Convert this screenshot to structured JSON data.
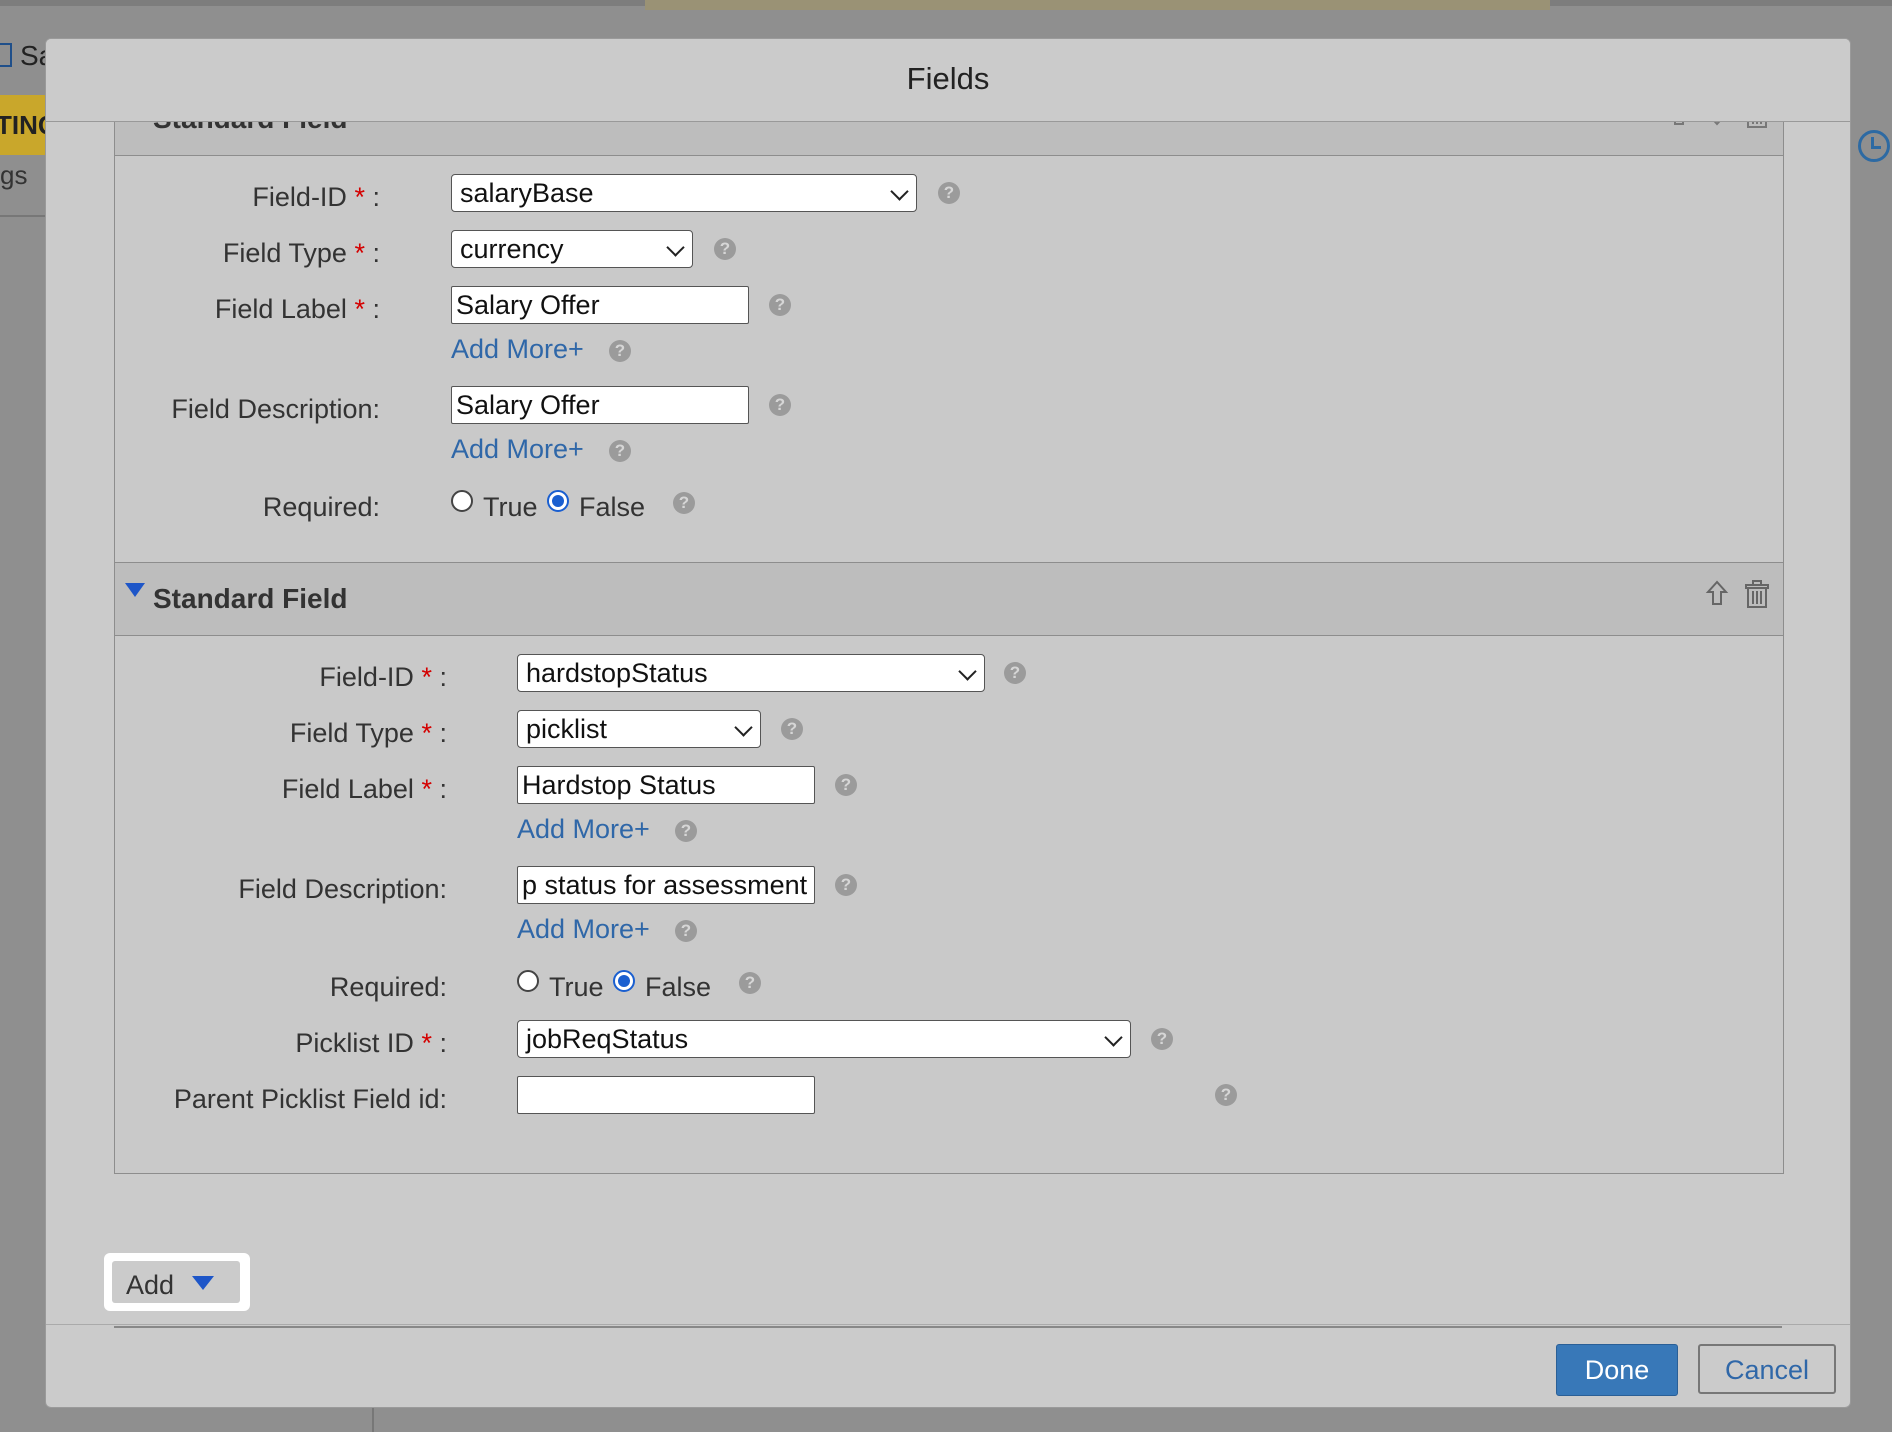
{
  "background": {
    "page_title_fragment": "Sa",
    "band_text": "TING",
    "side_text": "gs"
  },
  "modal": {
    "title": "Fields",
    "sections": [
      {
        "title": "Standard Field",
        "field_id_label": "Field-ID",
        "field_id_value": "salaryBase",
        "field_type_label": "Field Type",
        "field_type_value": "currency",
        "field_label_label": "Field Label",
        "field_label_value": "Salary Offer",
        "field_desc_label": "Field Description:",
        "field_desc_value": "Salary Offer",
        "add_more": "Add More+",
        "required_label": "Required:",
        "true_label": "True",
        "false_label": "False",
        "required_value": "False"
      },
      {
        "title": "Standard Field",
        "field_id_label": "Field-ID",
        "field_id_value": "hardstopStatus",
        "field_type_label": "Field Type",
        "field_type_value": "picklist",
        "field_label_label": "Field Label",
        "field_label_value": "Hardstop Status",
        "field_desc_label": "Field Description:",
        "field_desc_value": "p status for assessment",
        "add_more": "Add More+",
        "required_label": "Required:",
        "true_label": "True",
        "false_label": "False",
        "required_value": "False",
        "picklist_id_label": "Picklist ID",
        "picklist_id_value": "jobReqStatus",
        "parent_picklist_label": "Parent Picklist Field id:",
        "parent_picklist_value": ""
      }
    ],
    "required_marker": "*",
    "colon": ":",
    "help_glyph": "?",
    "add_button": "Add",
    "done_button": "Done",
    "cancel_button": "Cancel"
  },
  "colors": {
    "accent_blue": "#3878b8",
    "link_blue": "#2f67a8",
    "required_red": "#d40000",
    "band_yellow": "#c9a72b"
  }
}
